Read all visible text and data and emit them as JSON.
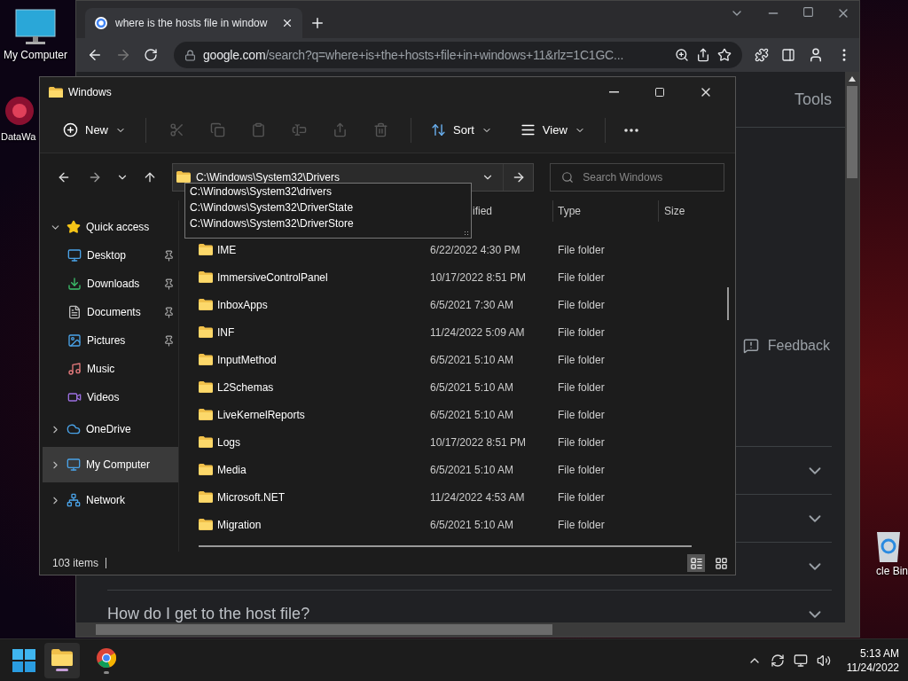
{
  "desktop_icons": [
    {
      "label": "My Computer"
    },
    {
      "label": "DataWa"
    },
    {
      "label": "cle Bin"
    }
  ],
  "browser": {
    "tab": {
      "title": "where is the hosts file in window",
      "selected": true
    },
    "address": {
      "domain": "google.com",
      "path": "/search?q=where+is+the+hosts+file+in+windows+11&rlz=1C1GC..."
    },
    "tools": "Tools",
    "feedback": "Feedback",
    "accordion_rows": [
      {
        "expanded": false
      },
      {
        "expanded": false
      },
      {
        "expanded": false
      },
      {
        "question": "How do I get to the host file?",
        "expanded": false
      }
    ]
  },
  "explorer": {
    "title": "Windows",
    "new_menu": {
      "label": "New"
    },
    "clipboard_actions": [
      {
        "disabled": true
      },
      {
        "disabled": true
      },
      {
        "disabled": true
      },
      {
        "disabled": true
      },
      {
        "disabled": true
      },
      {
        "disabled": true
      }
    ],
    "sort_menu": {
      "label": "Sort"
    },
    "view_menu": {
      "label": "View"
    },
    "address": {
      "value": "C:\\Windows\\System32\\Drivers"
    },
    "suggestions": [
      "C:\\Windows\\System32\\drivers",
      "C:\\Windows\\System32\\DriverState",
      "C:\\Windows\\System32\\DriverStore"
    ],
    "search": {
      "placeholder": "Search Windows"
    },
    "nav": [
      {
        "label": "Quick access",
        "expanded": true,
        "selected": false,
        "children": [
          {
            "label": "Desktop",
            "pinned": true,
            "selected": false
          },
          {
            "label": "Downloads",
            "pinned": true,
            "selected": false
          },
          {
            "label": "Documents",
            "pinned": true,
            "selected": false
          },
          {
            "label": "Pictures",
            "pinned": true,
            "selected": false
          },
          {
            "label": "Music",
            "pinned": false,
            "selected": false
          },
          {
            "label": "Videos",
            "pinned": false,
            "selected": false
          }
        ]
      },
      {
        "label": "OneDrive",
        "expanded": false,
        "selected": false
      },
      {
        "label": "My Computer",
        "expanded": false,
        "selected": true
      },
      {
        "label": "Network",
        "expanded": false,
        "selected": false
      }
    ],
    "columns": [
      "ified",
      "Type",
      "Size"
    ],
    "rows": [
      {
        "name": "IME",
        "date": "6/22/2022 4:30 PM",
        "type": "File folder"
      },
      {
        "name": "ImmersiveControlPanel",
        "date": "10/17/2022 8:51 PM",
        "type": "File folder"
      },
      {
        "name": "InboxApps",
        "date": "6/5/2021 7:30 AM",
        "type": "File folder"
      },
      {
        "name": "INF",
        "date": "11/24/2022 5:09 AM",
        "type": "File folder"
      },
      {
        "name": "InputMethod",
        "date": "6/5/2021 5:10 AM",
        "type": "File folder"
      },
      {
        "name": "L2Schemas",
        "date": "6/5/2021 5:10 AM",
        "type": "File folder"
      },
      {
        "name": "LiveKernelReports",
        "date": "6/5/2021 5:10 AM",
        "type": "File folder"
      },
      {
        "name": "Logs",
        "date": "10/17/2022 8:51 PM",
        "type": "File folder"
      },
      {
        "name": "Media",
        "date": "6/5/2021 5:10 AM",
        "type": "File folder"
      },
      {
        "name": "Microsoft.NET",
        "date": "11/24/2022 4:53 AM",
        "type": "File folder"
      },
      {
        "name": "Migration",
        "date": "6/5/2021 5:10 AM",
        "type": "File folder"
      }
    ],
    "status": "103 items",
    "view_modes": [
      {
        "selected": true
      },
      {
        "selected": false
      }
    ]
  },
  "taskbar": {
    "apps": [
      {
        "active": true
      },
      {
        "active": false
      }
    ],
    "time": "5:13 AM",
    "date": "11/24/2022"
  }
}
